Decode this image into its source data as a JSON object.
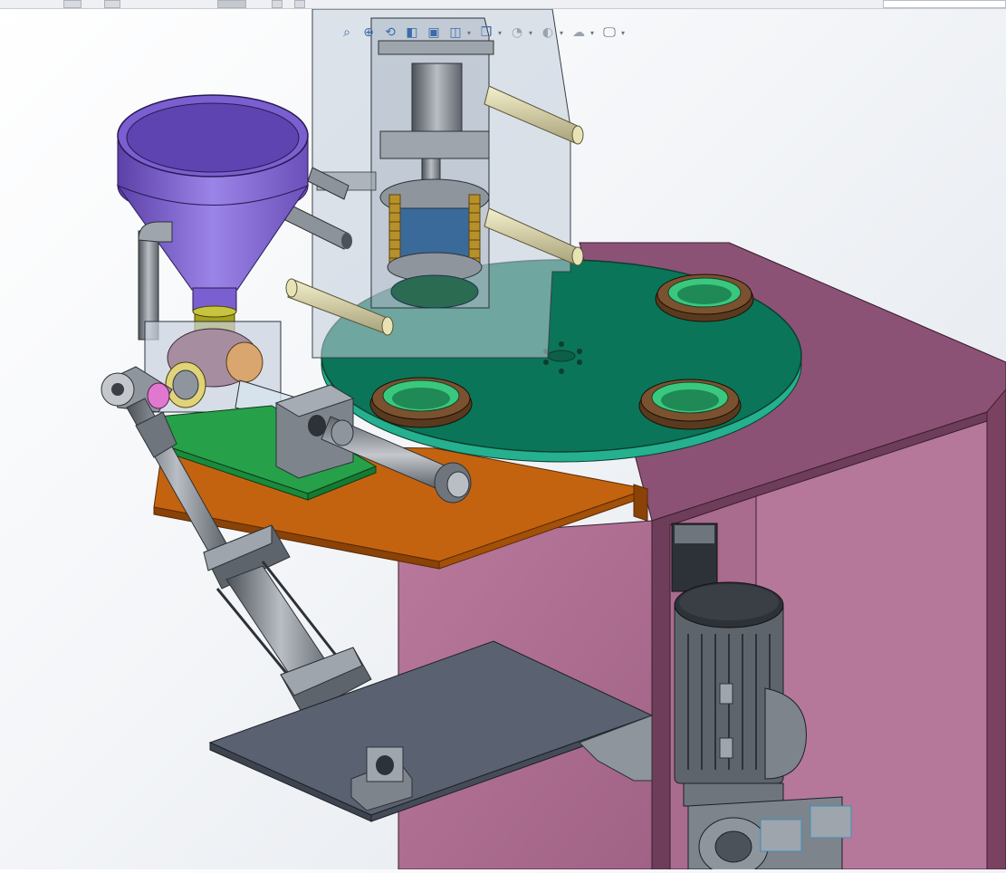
{
  "window": {
    "width": 1111,
    "height": 960
  },
  "heads_up_toolbar": {
    "items": [
      {
        "icon": "zoom-to-fit-icon"
      },
      {
        "icon": "zoom-area-icon"
      },
      {
        "icon": "previous-view-icon"
      },
      {
        "icon": "section-view-icon"
      },
      {
        "icon": "dynamic-annotation-icon"
      },
      {
        "icon": "view-orientation-icon"
      },
      {
        "icon": "display-style-icon"
      },
      {
        "icon": "hide-show-items-icon"
      },
      {
        "icon": "edit-appearance-icon"
      },
      {
        "icon": "apply-scene-icon"
      },
      {
        "icon": "view-settings-icon"
      }
    ]
  },
  "colors": {
    "frame": "#ab6c8f",
    "frame_dark": "#7a4260",
    "turntable": "#0a7558",
    "turntable_edge": "#25b08f",
    "hopper": "#8a70d8",
    "hopper_dark": "#5b40a8",
    "bracket": "#c4630f",
    "base_plate": "#27a04a",
    "metal": "#8d939b",
    "metal_dark": "#4c5259",
    "guard_glass": "#b8c4d0",
    "cup_green": "#39c87e",
    "cup_brown": "#5a3a1e",
    "cylinder_bar": "#e8e3b4",
    "spring": "#b8902a"
  }
}
